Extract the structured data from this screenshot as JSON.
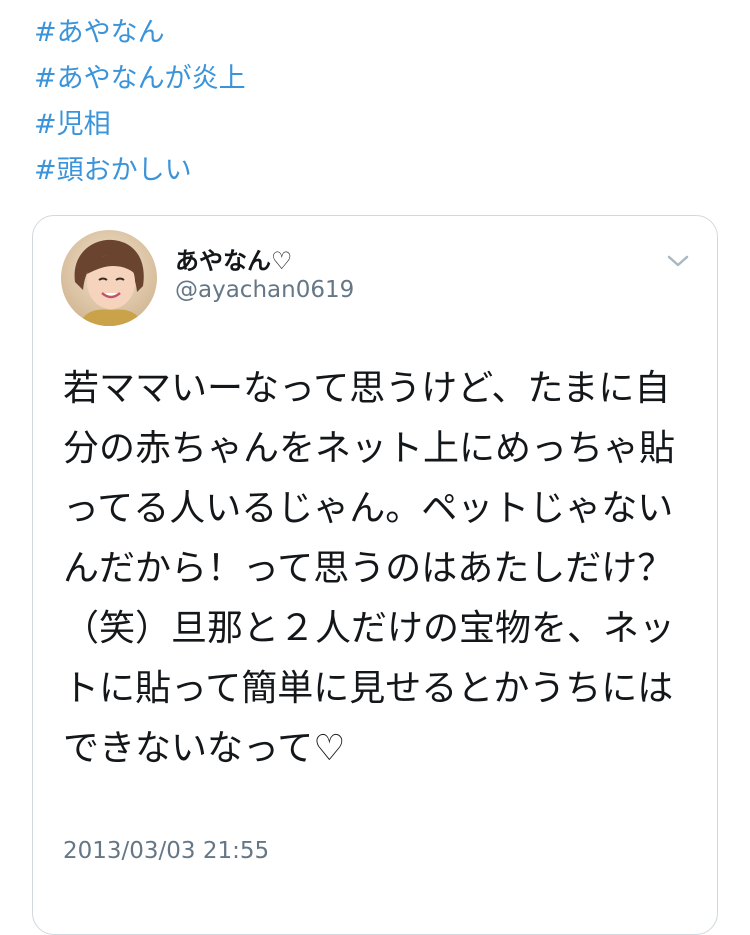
{
  "hashtags": [
    "#あやなん",
    "#あやなんが炎上",
    "#児相",
    "#頭おかしい"
  ],
  "quoted_tweet": {
    "display_name": "あやなん♡",
    "handle": "@ayachan0619",
    "text": "若ママいーなって思うけど、たまに自分の赤ちゃんをネット上にめっちゃ貼ってる人いるじゃん。ペットじゃないんだから！って思うのはあたしだけ？（笑）旦那と２人だけの宝物を、ネットに貼って簡単に見せるとかうちにはできないなって♡",
    "timestamp": "2013/03/03 21:55",
    "avatar_icon": "profile-photo",
    "menu_icon": "chevron-down-icon"
  },
  "colors": {
    "link": "#3b94d9",
    "text": "#14171a",
    "muted": "#657786",
    "border": "#cfd9de"
  }
}
